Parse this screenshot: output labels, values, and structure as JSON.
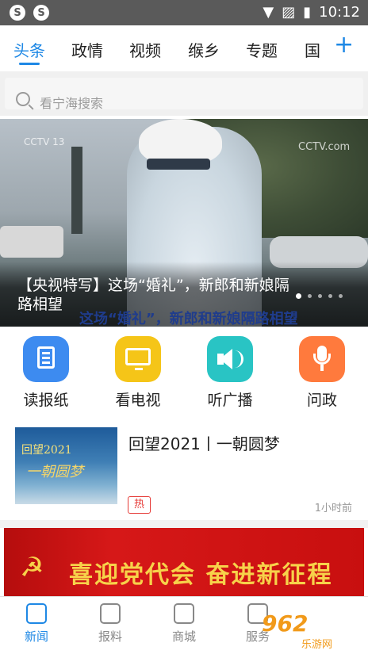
{
  "status": {
    "time": "10:12"
  },
  "tabs": [
    {
      "label": "头条"
    },
    {
      "label": "政情"
    },
    {
      "label": "视频"
    },
    {
      "label": "缑乡"
    },
    {
      "label": "专题"
    },
    {
      "label": "国"
    }
  ],
  "search": {
    "placeholder": "看宁海搜索"
  },
  "banner": {
    "caption": "【央视特写】这场“婚礼”，新郎和新娘隔路相望",
    "subtitle": "这场“婚礼”，新郎和新娘隔路相望",
    "logo_left": "CCTV 13",
    "logo_right": "CCTV.com"
  },
  "quick": [
    {
      "label": "读报纸",
      "color": "#3d8bf0"
    },
    {
      "label": "看电视",
      "color": "#f5c518"
    },
    {
      "label": "听广播",
      "color": "#29c4c4"
    },
    {
      "label": "问政",
      "color": "#ff7a3d"
    }
  ],
  "news": {
    "title": "回望2021丨一朝圆梦",
    "tag": "热",
    "time": "1小时前",
    "thumb_line1": "回望2021",
    "thumb_line2": "一朝圆梦"
  },
  "promo": {
    "text": "喜迎党代会  奋进新征程"
  },
  "bottom_nav": [
    {
      "label": "新闻"
    },
    {
      "label": "报料"
    },
    {
      "label": "商城"
    },
    {
      "label": "服务"
    }
  ],
  "watermark": {
    "logo": "962",
    "sub": "乐游网"
  },
  "colors": {
    "accent": "#1e88e5",
    "hot": "#e53935"
  }
}
